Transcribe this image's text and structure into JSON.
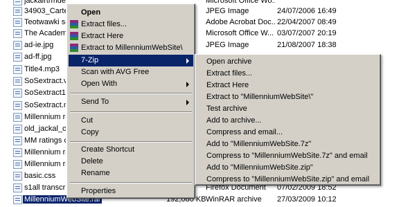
{
  "files": [
    {
      "name": "jackalrtrmdese",
      "size": "",
      "type": "Microsoft Office Wo...",
      "date": ""
    },
    {
      "name": "34903_Carte",
      "size": "",
      "type": "JPEG Image",
      "date": "24/07/2006 16:49"
    },
    {
      "name": "Teotwawki so",
      "size": "",
      "type": "Adobe Acrobat Doc...",
      "date": "22/04/2007 08:49"
    },
    {
      "name": "The Academy",
      "size": "",
      "type": "Microsoft Office W...",
      "date": "03/07/2007 20:19"
    },
    {
      "name": "ad-ie.jpg",
      "size": "",
      "type": "JPEG Image",
      "date": "21/08/2007 18:38"
    },
    {
      "name": "ad-ff.jpg",
      "size": "",
      "type": "",
      "date": ""
    },
    {
      "name": "Title4.mp3",
      "size": "",
      "type": "",
      "date": ""
    },
    {
      "name": "SoSextract.v",
      "size": "",
      "type": "",
      "date": ""
    },
    {
      "name": "SoSextract1.",
      "size": "",
      "type": "",
      "date": ""
    },
    {
      "name": "SoSextract.n",
      "size": "",
      "type": "",
      "date": ""
    },
    {
      "name": "Millennium ra",
      "size": "",
      "type": "",
      "date": ""
    },
    {
      "name": "old_jackal_cr",
      "size": "",
      "type": "",
      "date": ""
    },
    {
      "name": "MM ratings c",
      "size": "",
      "type": "",
      "date": ""
    },
    {
      "name": "Millennium ra",
      "size": "",
      "type": "",
      "date": ""
    },
    {
      "name": "Millennium ra",
      "size": "",
      "type": "",
      "date": ""
    },
    {
      "name": "basic.css",
      "size": "",
      "type": "",
      "date": ""
    },
    {
      "name": "s1all transcrip",
      "size": "",
      "type": "Firefox Document",
      "date": "07/02/2009 18:52"
    },
    {
      "name": "MillenniumWebSite.rar",
      "size": "192,080 KB",
      "type": "WinRAR archive",
      "date": "27/03/2009 10:12"
    }
  ],
  "context_menu": {
    "open": "Open",
    "extract_files": "Extract files...",
    "extract_here": "Extract Here",
    "extract_to": "Extract to MillenniumWebSite\\",
    "seven_zip": "7-Zip",
    "scan": "Scan with AVG Free",
    "open_with": "Open With",
    "send_to": "Send To",
    "cut": "Cut",
    "copy": "Copy",
    "create_shortcut": "Create Shortcut",
    "delete": "Delete",
    "rename": "Rename",
    "properties": "Properties"
  },
  "submenu": [
    "Open archive",
    "Extract files...",
    "Extract Here",
    "Extract to \"MillenniumWebSite\\\"",
    "Test archive",
    "Add to archive...",
    "Compress and email...",
    "Add to \"MillenniumWebSite.7z\"",
    "Compress to \"MillenniumWebSite.7z\" and email",
    "Add to \"MillenniumWebSite.zip\"",
    "Compress to \"MillenniumWebSite.zip\" and email"
  ],
  "colors": {
    "menu_bg": "#d4d0c8",
    "highlight": "#0a246a",
    "highlight_text": "#ffffff"
  }
}
